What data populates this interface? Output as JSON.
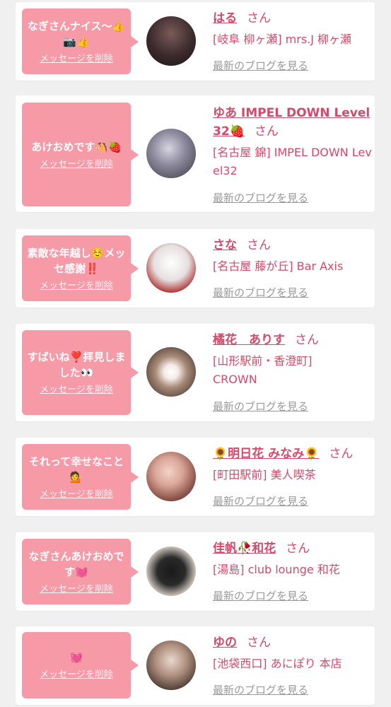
{
  "delete_label": "メッセージを削除",
  "san_label": "さん",
  "blog_label": "最新のブログを見る",
  "entries": [
    {
      "message": "なぎさんナイス〜👍📷👍",
      "name": "はる",
      "shop": "[岐阜 柳ヶ瀬] mrs.J 柳ヶ瀬"
    },
    {
      "message": "あけおめです🐴🍓",
      "name": "ゆあ IMPEL DOWN Level32🍓",
      "shop": "[名古屋 錦] IMPEL DOWN Level32"
    },
    {
      "message": "素敵な年越し☺️メッセ感謝‼️",
      "name": "さな",
      "shop": "[名古屋 藤が丘] Bar Axis"
    },
    {
      "message": "すばいね❣️拝見しました👀",
      "name": "橘花　ありす",
      "shop": "[山形駅前・香澄町] CROWN"
    },
    {
      "message": "それって幸せなこと💁",
      "name": "🌻明日花 みなみ🌻",
      "shop": "[町田駅前] 美人喫茶"
    },
    {
      "message": "なぎさんあけおめです💓",
      "name": "佳帆🥀和花",
      "shop": "[湯島] club lounge 和花"
    },
    {
      "message": "💓",
      "name": "ゆの",
      "shop": "[池袋西口] あにぽり 本店"
    }
  ]
}
